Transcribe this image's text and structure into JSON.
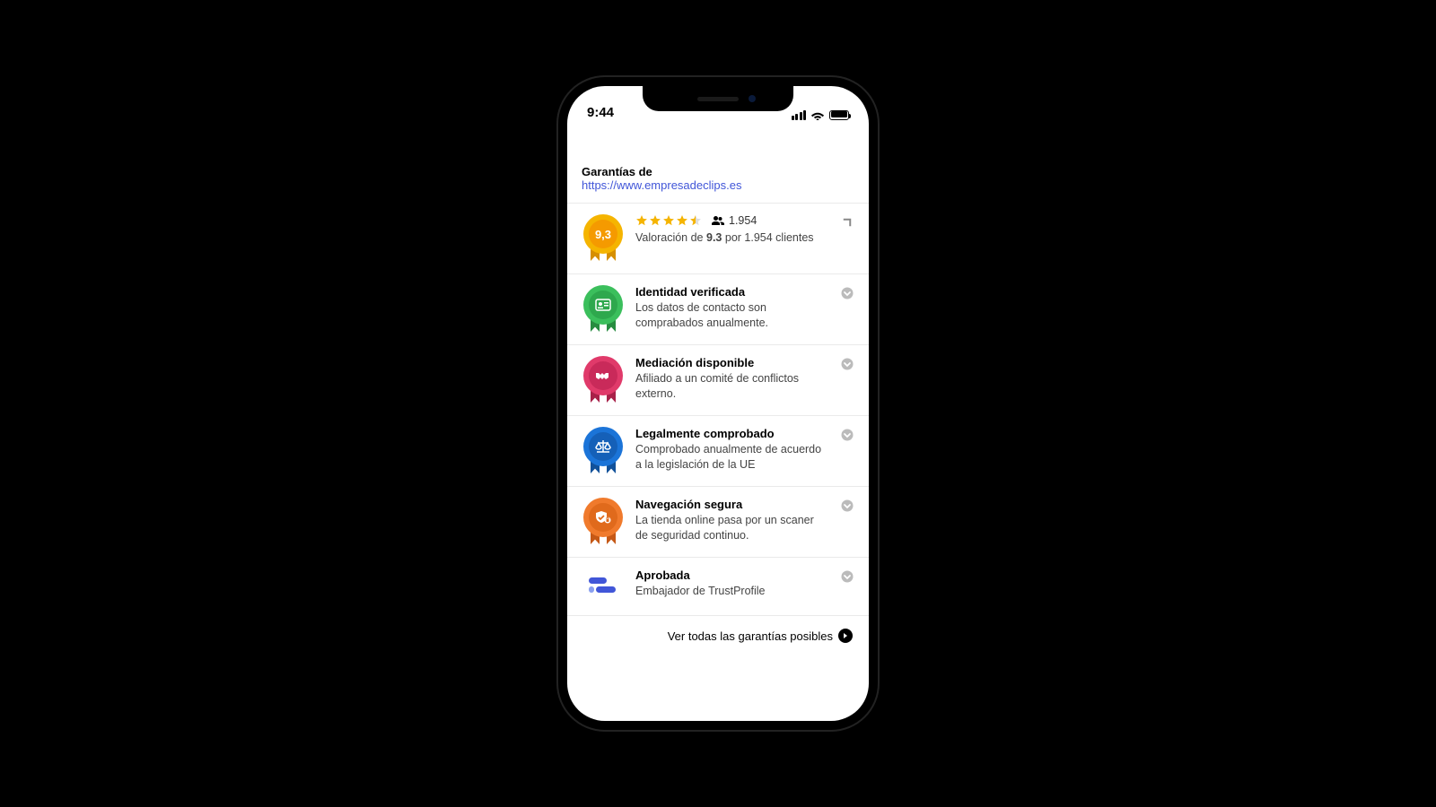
{
  "status": {
    "time": "9:44"
  },
  "header": {
    "label": "Garantías de",
    "url": "https://www.empresadeclips.es"
  },
  "rating": {
    "score_display": "9,3",
    "score_strong": "9.3",
    "count": "1.954",
    "desc_prefix": "Valoración de ",
    "desc_mid": " por ",
    "desc_suffix": " clientes"
  },
  "items": {
    "identity": {
      "title": "Identidad verificada",
      "desc": "Los datos de contacto son comprabados anualmente."
    },
    "mediation": {
      "title": "Mediación disponible",
      "desc": "Afiliado a un comité de conflictos externo."
    },
    "legal": {
      "title": "Legalmente comprobado",
      "desc": "Comprobado anualmente de acuerdo a la legislación de la UE"
    },
    "secure": {
      "title": "Navegación segura",
      "desc": "La tienda online pasa por un scaner de seguridad continuo."
    },
    "approved": {
      "title": "Aprobada",
      "desc": "Embajador de TrustProfile"
    }
  },
  "footer": {
    "label": "Ver todas las garantías posibles"
  }
}
